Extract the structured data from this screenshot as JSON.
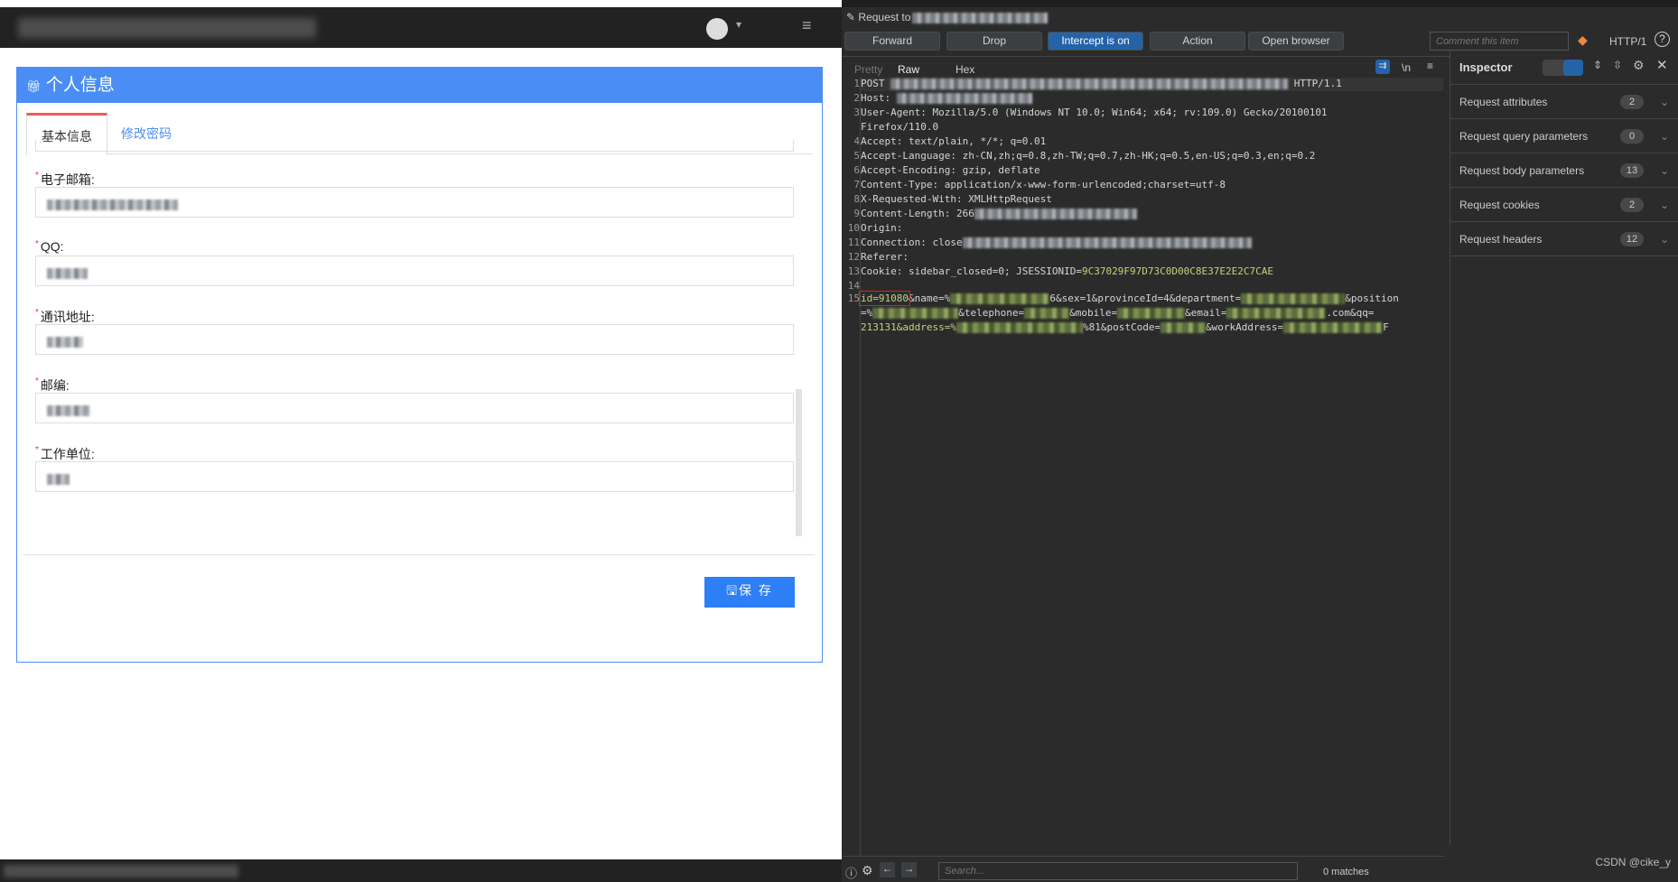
{
  "browser": {
    "card_title": "个人信息",
    "tabs": [
      "基本信息",
      "修改密码"
    ],
    "fields": [
      {
        "label": "电子邮箱:"
      },
      {
        "label": "QQ:"
      },
      {
        "label": "通讯地址:"
      },
      {
        "label": "邮编:"
      },
      {
        "label": "工作单位:"
      }
    ],
    "required_mark": "*",
    "save_label": "保  存"
  },
  "burp": {
    "request_title": "Request to",
    "buttons": [
      "Forward",
      "Drop",
      "Intercept is on",
      "Action",
      "Open browser"
    ],
    "comment_placeholder": "Comment this item",
    "http_version": "HTTP/1",
    "view_tabs": [
      "Pretty",
      "Raw",
      "Hex"
    ],
    "newline_toggle": "\\n",
    "lines": [
      {
        "n": "1",
        "text": "POST ",
        "tail": " HTTP/1.1"
      },
      {
        "n": "2",
        "text": "Host: "
      },
      {
        "n": "3",
        "text": "User-Agent: Mozilla/5.0 (Windows NT 10.0; Win64; x64; rv:109.0) Gecko/20100101"
      },
      {
        "n": "",
        "text": "Firefox/110.0"
      },
      {
        "n": "4",
        "text": "Accept: text/plain, */*; q=0.01"
      },
      {
        "n": "5",
        "text": "Accept-Language: zh-CN,zh;q=0.8,zh-TW;q=0.7,zh-HK;q=0.5,en-US;q=0.3,en;q=0.2"
      },
      {
        "n": "6",
        "text": "Accept-Encoding: gzip, deflate"
      },
      {
        "n": "7",
        "text": "Content-Type: application/x-www-form-urlencoded;charset=utf-8"
      },
      {
        "n": "8",
        "text": "X-Requested-With: XMLHttpRequest"
      },
      {
        "n": "9",
        "text": "Content-Length: 266"
      },
      {
        "n": "10",
        "text": "Origin: "
      },
      {
        "n": "11",
        "text": "Connection: close"
      },
      {
        "n": "12",
        "text": "Referer: "
      },
      {
        "n": "13",
        "text": "Cookie: sidebar_closed=0; JSESSIONID=",
        "tail": "9C37029F97D73C0D00C8E37E2E2C7CAE"
      },
      {
        "n": "14",
        "text": ""
      }
    ],
    "body": {
      "n": "15",
      "id_part": "id=91080",
      "p1": "&name=%",
      "p2": "6&sex=1&provinceId=4&department=",
      "p3": "&position",
      "p4": "=%",
      "p5": "&telephone=",
      "p6": "&mobile=",
      "p7": "&email=",
      "p8": ".com&qq=",
      "p9": "213131&address=%",
      "p10": "%81&postCode=",
      "p11": "&workAddress=",
      "p12": "F"
    },
    "inspector": {
      "title": "Inspector",
      "rows": [
        {
          "label": "Request attributes",
          "count": "2"
        },
        {
          "label": "Request query parameters",
          "count": "0"
        },
        {
          "label": "Request body parameters",
          "count": "13"
        },
        {
          "label": "Request cookies",
          "count": "2"
        },
        {
          "label": "Request headers",
          "count": "12"
        }
      ]
    },
    "search_placeholder": "Search...",
    "matches": "0 matches"
  },
  "watermark": "CSDN @cike_y",
  "colors": {
    "accent": "#4a8ef5",
    "intercept": "#2563a8",
    "highlight_box": "#e02020"
  }
}
